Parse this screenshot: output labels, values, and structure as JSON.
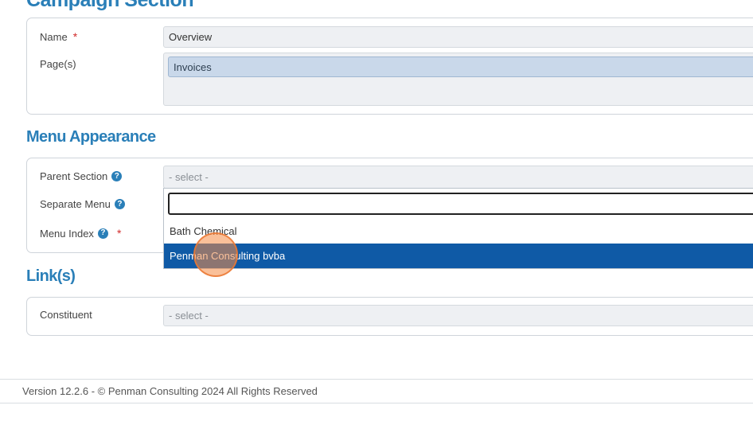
{
  "header": {
    "title": "Campaign Section"
  },
  "campaign": {
    "name_label": "Name",
    "name_required": "*",
    "name_value": "Overview",
    "pages_label": "Page(s)",
    "pages_tag": "Invoices"
  },
  "menu_appearance": {
    "title": "Menu Appearance",
    "parent_section_label": "Parent Section",
    "parent_section_value": "- select -",
    "separate_menu_label": "Separate Menu",
    "menu_index_label": "Menu Index",
    "menu_index_required": "*",
    "help_glyph": "?",
    "dropdown": {
      "search_value": "",
      "options": [
        "Bath Chemical",
        "Penman Consulting bvba"
      ],
      "highlighted": "Penman Consulting bvba"
    }
  },
  "links": {
    "title": "Link(s)",
    "constituent_label": "Constituent",
    "constituent_value": "- select -"
  },
  "footer": {
    "text": "Version 12.2.6 - © Penman Consulting 2024 All Rights Reserved"
  },
  "colors": {
    "accent": "#2a7fb8",
    "highlight": "#0f5aa6",
    "required": "#d12b2b",
    "click_marker": "#f58c46"
  }
}
